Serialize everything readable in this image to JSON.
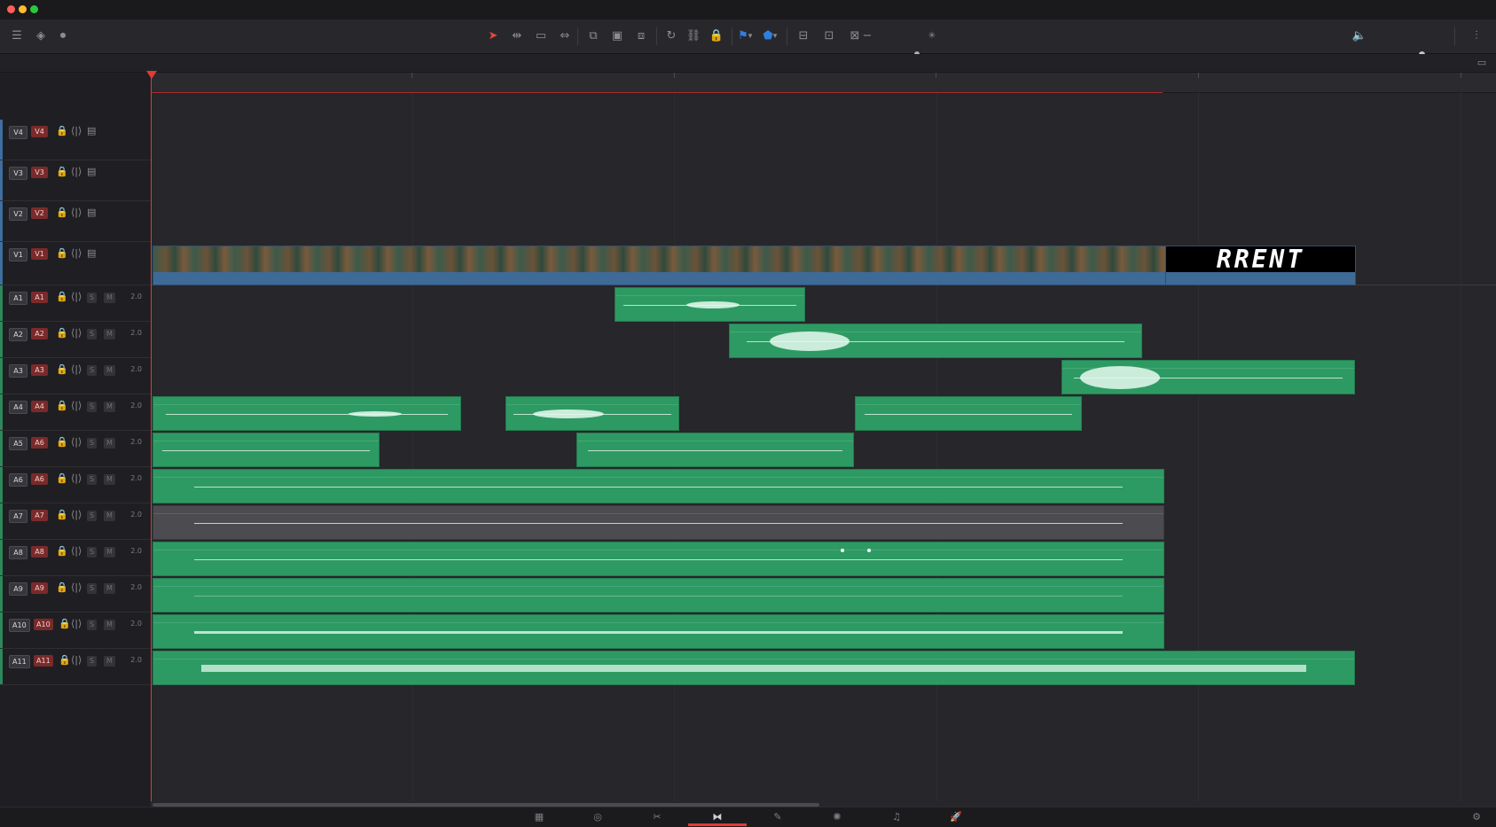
{
  "window": {
    "controls": [
      {
        "name": "close",
        "color": "#ff5f57"
      },
      {
        "name": "minimize",
        "color": "#febc2e"
      },
      {
        "name": "maximize",
        "color": "#28c840"
      }
    ]
  },
  "toolbar": {
    "left_icons": [
      "timeline-view-icon",
      "layers-icon",
      "microphone-icon"
    ],
    "edit_icons": [
      "selection-arrow-icon",
      "trim-edit-icon",
      "dynamic-trim-icon",
      "blade-icon",
      "insert-clip-icon",
      "overwrite-clip-icon",
      "replace-clip-icon",
      "snapping-icon",
      "linked-selection-icon",
      "position-lock-icon",
      "flag-icon",
      "marker-icon",
      "zoom-full-icon",
      "zoom-detail-icon",
      "zoom-custom-icon",
      "zoom-out-icon",
      "zoom-in-icon"
    ],
    "right_icons": [
      "volume-icon",
      "sidebar-icon",
      "mixer-icon"
    ],
    "active_tool_color": "#e8453c",
    "flag_color": "#2f7fe0"
  },
  "tracks": {
    "video": [
      {
        "id": "V4",
        "name": "V4"
      },
      {
        "id": "V3",
        "name": "V3"
      },
      {
        "id": "V2",
        "name": "V2"
      },
      {
        "id": "V1",
        "name": "V1"
      }
    ],
    "audio": [
      {
        "id": "A1",
        "name": "A1",
        "channels": "2.0",
        "solo": "S",
        "mute": "M"
      },
      {
        "id": "A2",
        "name": "A2",
        "channels": "2.0",
        "solo": "S",
        "mute": "M"
      },
      {
        "id": "A3",
        "name": "A3",
        "channels": "2.0",
        "solo": "S",
        "mute": "M"
      },
      {
        "id": "A4",
        "name": "A4",
        "channels": "2.0",
        "solo": "S",
        "mute": "M"
      },
      {
        "id": "A5",
        "name": "A6",
        "channels": "2.0",
        "solo": "S",
        "mute": "M"
      },
      {
        "id": "A6",
        "name": "A6",
        "channels": "2.0",
        "solo": "S",
        "mute": "M"
      },
      {
        "id": "A7",
        "name": "A7",
        "channels": "2.0",
        "solo": "S",
        "mute": "M"
      },
      {
        "id": "A8",
        "name": "A8",
        "channels": "2.0",
        "solo": "S",
        "mute": "M"
      },
      {
        "id": "A9",
        "name": "A9",
        "channels": "2.0",
        "solo": "S",
        "mute": "M"
      },
      {
        "id": "A10",
        "name": "A10",
        "channels": "2.0",
        "solo": "S",
        "mute": "M"
      },
      {
        "id": "A11",
        "name": "A11",
        "channels": "2.0",
        "solo": "S",
        "mute": "M"
      }
    ]
  },
  "clips": {
    "title_text": "RRENT"
  },
  "colors": {
    "audio_clip": "#2e9a63",
    "video_clip": "#3e6a95",
    "playhead": "#e53935",
    "volume": "#2fb04a"
  },
  "bottom_pages": [
    "media-page-icon",
    "cut-page-icon",
    "edit-page-icon",
    "fusion-page-icon",
    "color-page-icon",
    "fairlight-page-icon",
    "deliver-page-icon",
    "settings-icon"
  ],
  "active_page": "fusion-page-icon"
}
